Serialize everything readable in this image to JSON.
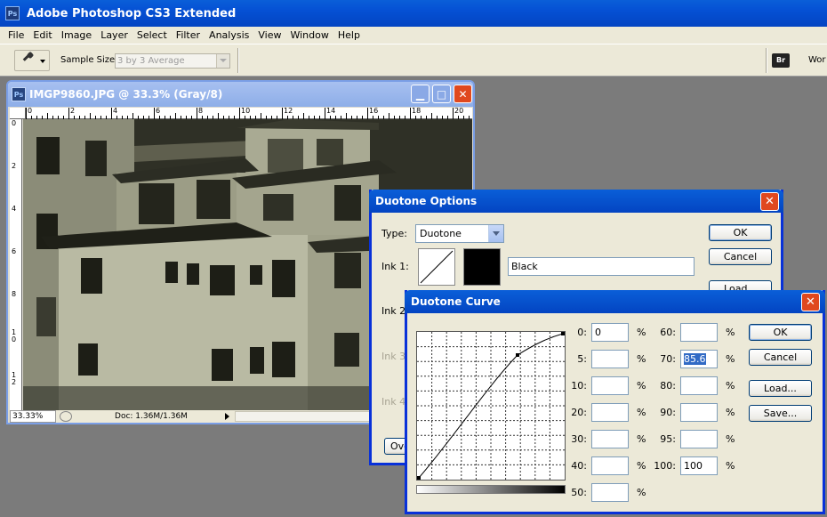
{
  "app": {
    "title": "Adobe Photoshop CS3 Extended",
    "icon": "ps-icon"
  },
  "menu": [
    "File",
    "Edit",
    "Image",
    "Layer",
    "Select",
    "Filter",
    "Analysis",
    "View",
    "Window",
    "Help"
  ],
  "options": {
    "sample_size_label": "Sample Size:",
    "sample_size_value": "3 by 3 Average",
    "workspace_label": "Wor"
  },
  "document": {
    "title": "IMGP9860.JPG @ 33.3% (Gray/8)",
    "zoom": "33.33%",
    "doc_info": "Doc: 1.36M/1.36M",
    "ruler_h": [
      "0",
      "2",
      "4",
      "6",
      "8",
      "10",
      "12",
      "14",
      "16",
      "18",
      "20"
    ],
    "ruler_v": [
      "0",
      "2",
      "4",
      "6",
      "8",
      "1\n0",
      "1\n2"
    ]
  },
  "duotone_options": {
    "title": "Duotone Options",
    "type_label": "Type:",
    "type_value": "Duotone",
    "ink1_label": "Ink 1:",
    "ink1_name": "Black",
    "ink2_label": "Ink 2",
    "ink3_label": "Ink 3",
    "ink4_label": "Ink 4",
    "overprint_label": "Ove",
    "ok": "OK",
    "cancel": "Cancel",
    "load": "Load..."
  },
  "duotone_curve": {
    "title": "Duotone Curve",
    "ok": "OK",
    "cancel": "Cancel",
    "load": "Load...",
    "save": "Save...",
    "left_col": [
      {
        "label": "0:",
        "value": "0"
      },
      {
        "label": "5:",
        "value": ""
      },
      {
        "label": "10:",
        "value": ""
      },
      {
        "label": "20:",
        "value": ""
      },
      {
        "label": "30:",
        "value": ""
      },
      {
        "label": "40:",
        "value": ""
      },
      {
        "label": "50:",
        "value": ""
      }
    ],
    "right_col": [
      {
        "label": "60:",
        "value": ""
      },
      {
        "label": "70:",
        "value": "85.6"
      },
      {
        "label": "80:",
        "value": ""
      },
      {
        "label": "90:",
        "value": ""
      },
      {
        "label": "95:",
        "value": ""
      },
      {
        "label": "100:",
        "value": "100"
      }
    ],
    "percent": "%"
  }
}
